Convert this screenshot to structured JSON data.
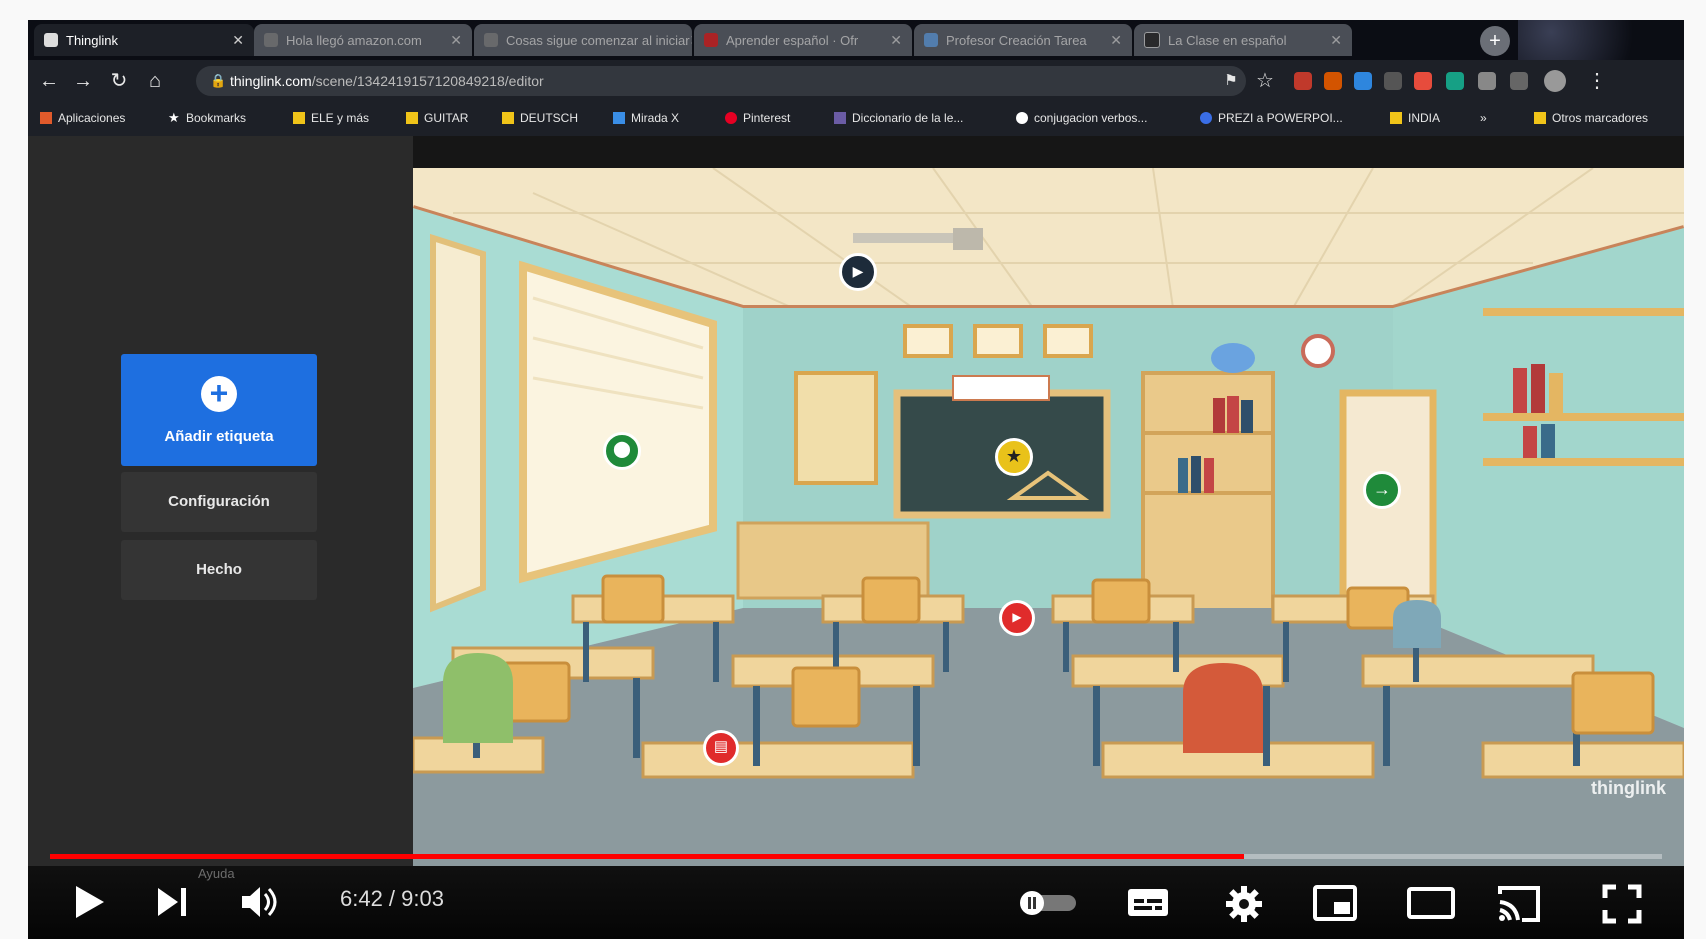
{
  "browser": {
    "tabs": [
      {
        "title": "Thinglink",
        "state": "active"
      },
      {
        "title": "Hola llegó amazon.com",
        "state": "inactive"
      },
      {
        "title": "Cosas sigue comenzar al iniciar",
        "state": "inactive"
      },
      {
        "title": "Aprender español · Ofr",
        "state": "inactive"
      },
      {
        "title": "Profesor Creación Tarea",
        "state": "inactive"
      },
      {
        "title": "La Clase en español",
        "state": "inactive"
      }
    ],
    "new_tab_symbol": "+",
    "url_host": "thinglink.com",
    "url_path": "/scene/1342419157120849218/editor",
    "bookmarks": [
      {
        "label": "Aplicaciones",
        "icon": "apps-grid-icon"
      },
      {
        "label": "Bookmarks",
        "icon": "star-icon"
      },
      {
        "label": "ELE y más",
        "icon": "folder-icon"
      },
      {
        "label": "GUITAR",
        "icon": "folder-icon"
      },
      {
        "label": "DEUTSCH",
        "icon": "folder-icon"
      },
      {
        "label": "Mirada X",
        "icon": "chart-icon"
      },
      {
        "label": "Pinterest",
        "icon": "pinterest-icon"
      },
      {
        "label": "Diccionario de la le...",
        "icon": "dictionary-icon"
      },
      {
        "label": "conjugacion verbos...",
        "icon": "globe-icon"
      },
      {
        "label": "PREZI a POWERPOI...",
        "icon": "prezi-icon"
      },
      {
        "label": "INDIA",
        "icon": "folder-icon"
      },
      {
        "label": "»",
        "icon": ""
      },
      {
        "label": "Otros marcadores",
        "icon": "folder-icon"
      }
    ]
  },
  "editor": {
    "add_tag_label": "Añadir etiqueta",
    "settings_label": "Configuración",
    "done_label": "Hecho",
    "hotspots": [
      {
        "name": "video-hotspot",
        "color": "#1d2b3a",
        "icon": "video-camera-icon"
      },
      {
        "name": "location-hotspot",
        "color": "#1f8a3a",
        "icon": "map-pin-icon"
      },
      {
        "name": "star-hotspot",
        "color": "#e9c21a",
        "icon": "star-icon"
      },
      {
        "name": "arrow-hotspot",
        "color": "#1f8a3a",
        "icon": "arrow-right-icon"
      },
      {
        "name": "youtube-hotspot",
        "color": "#e02b2b",
        "icon": "youtube-icon"
      },
      {
        "name": "book-hotspot",
        "color": "#e02b2b",
        "icon": "book-icon"
      }
    ],
    "watermark": "thinglink"
  },
  "player": {
    "time_current": "6:42",
    "time_total": "9:03",
    "time_display": "6:42 / 9:03",
    "progress": 0.741,
    "accent_color": "#ff0000",
    "hint_text": "Ayuda",
    "controls": [
      "play-icon",
      "next-icon",
      "volume-icon",
      "autoplay-toggle",
      "subtitles-icon",
      "settings-icon",
      "miniplayer-icon",
      "theater-icon",
      "cast-icon",
      "fullscreen-icon"
    ]
  }
}
